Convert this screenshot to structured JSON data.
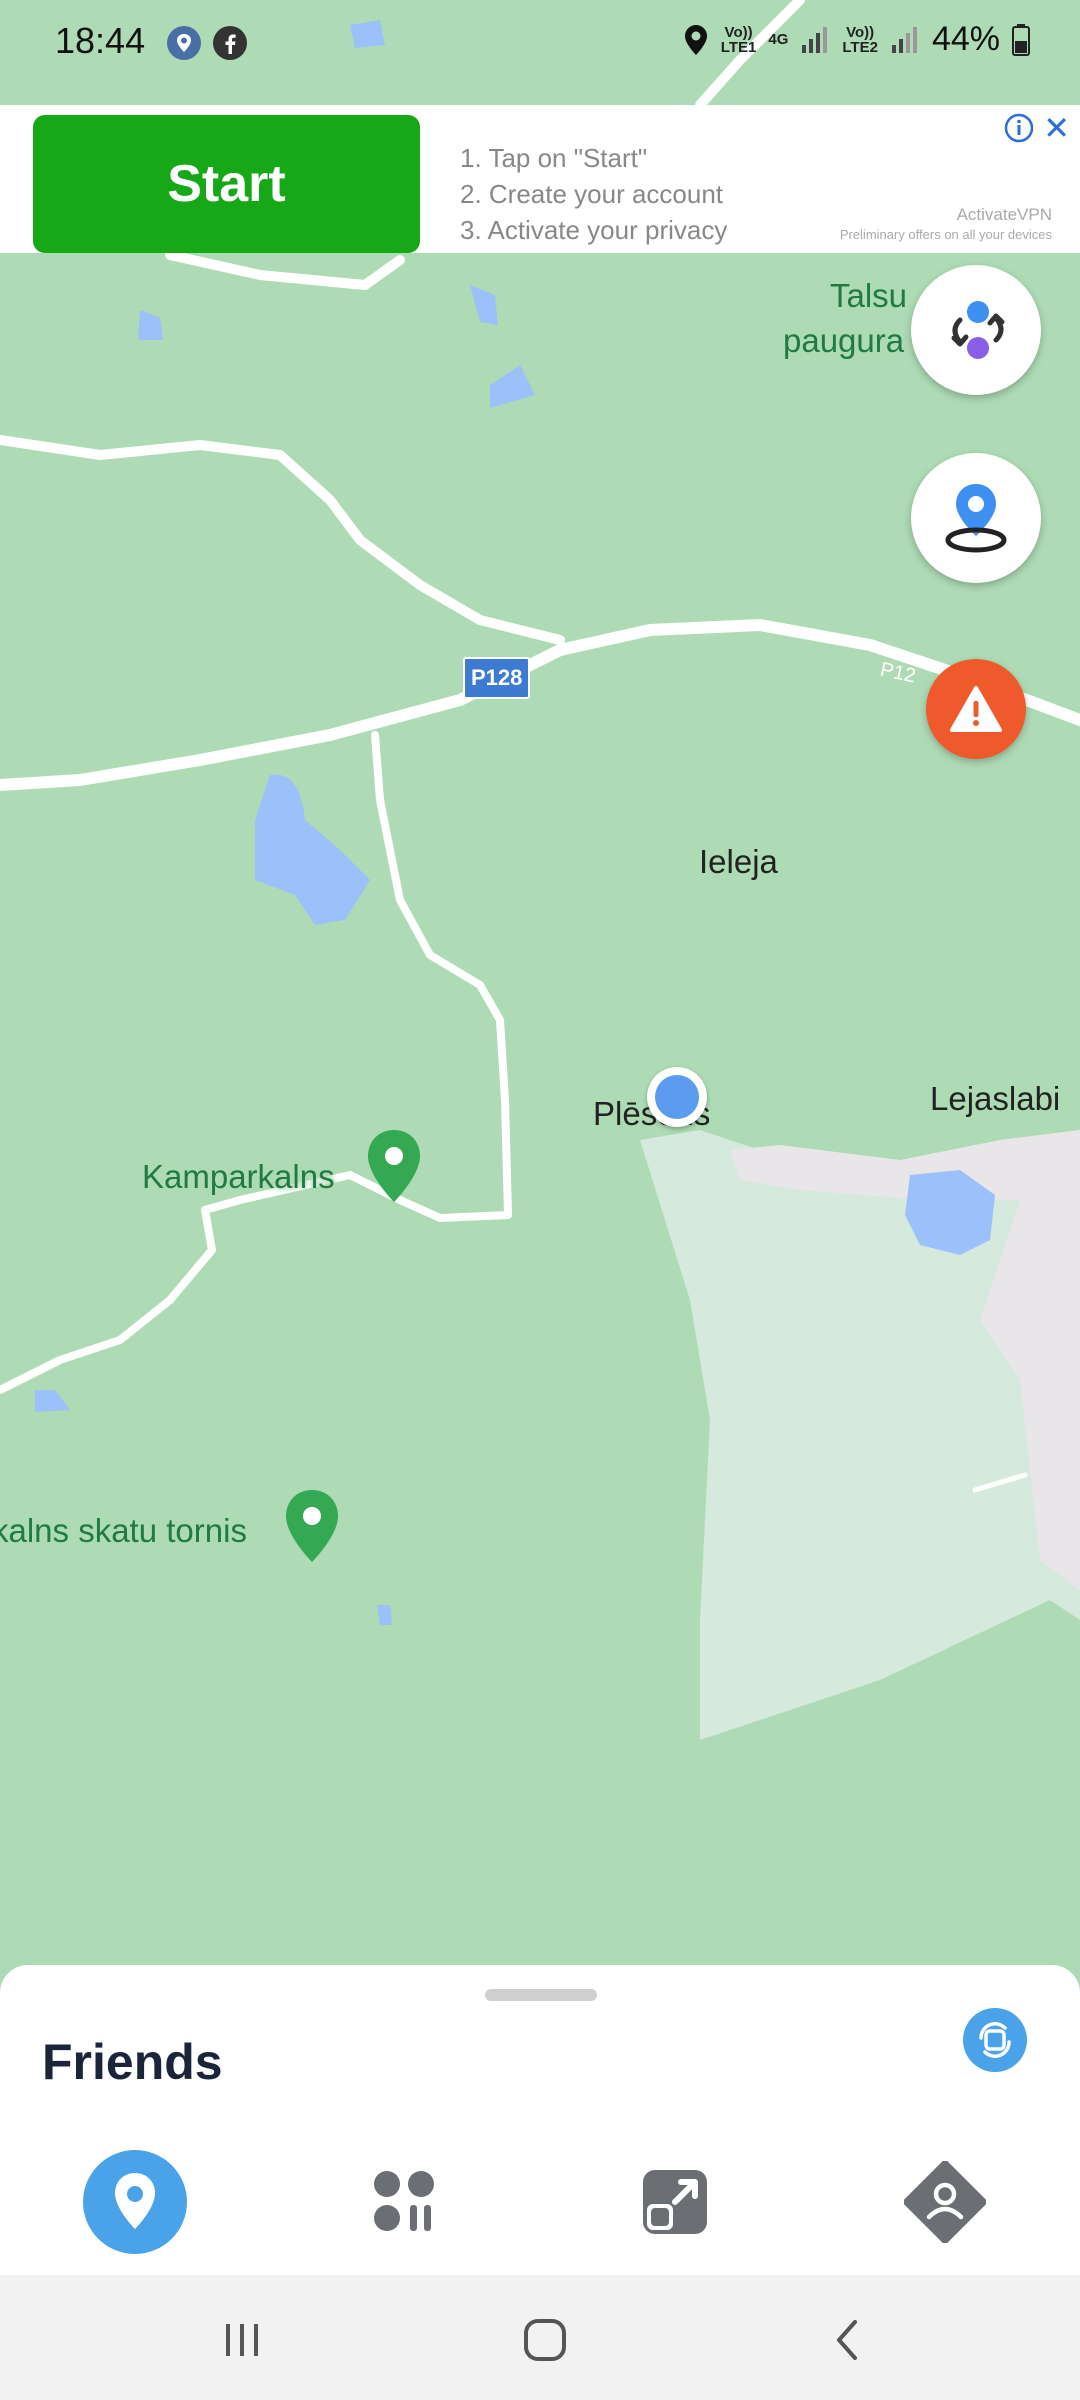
{
  "status_bar": {
    "time": "18:44",
    "net1_top": "Vo))",
    "net1_bottom": "LTE1",
    "net_4g": "4G",
    "net2_top": "Vo))",
    "net2_bottom": "LTE2",
    "battery": "44%"
  },
  "ad": {
    "button_label": "Start",
    "step1": "1. Tap on \"Start\"",
    "step2": "2. Create your account",
    "step3": "3. Activate your privacy",
    "brand": "ActivateVPN",
    "brand_sub": "Preliminary offers on all your devices",
    "close_label": "✕"
  },
  "map": {
    "road_shield": "P128",
    "road_shield_2": "P12",
    "labels": {
      "talsu": "Talsu",
      "paugura": "paugura",
      "ieleja": "Ieleja",
      "plesons": "Plēsons",
      "lejaslabi": "Lejaslabi",
      "kamparkalns": "Kamparkalns",
      "tornis": "kalns skatu tornis"
    }
  },
  "sheet": {
    "title": "Friends"
  },
  "colors": {
    "map_green": "#aedbb5",
    "water": "#9cc0f9",
    "road": "#ffffff",
    "alert": "#ee5a2b",
    "accent_blue": "#4aa3e8",
    "poi_green": "#34a853",
    "tab_gray": "#6b6e72",
    "ad_green": "#16a816"
  },
  "icons": [
    "location-icon",
    "facebook-icon",
    "swap-icon",
    "person-pin-icon",
    "warning-icon",
    "refresh-icon",
    "map-pin-icon",
    "apps-icon",
    "share-icon",
    "profile-icon",
    "recents-icon",
    "home-icon",
    "back-icon"
  ]
}
